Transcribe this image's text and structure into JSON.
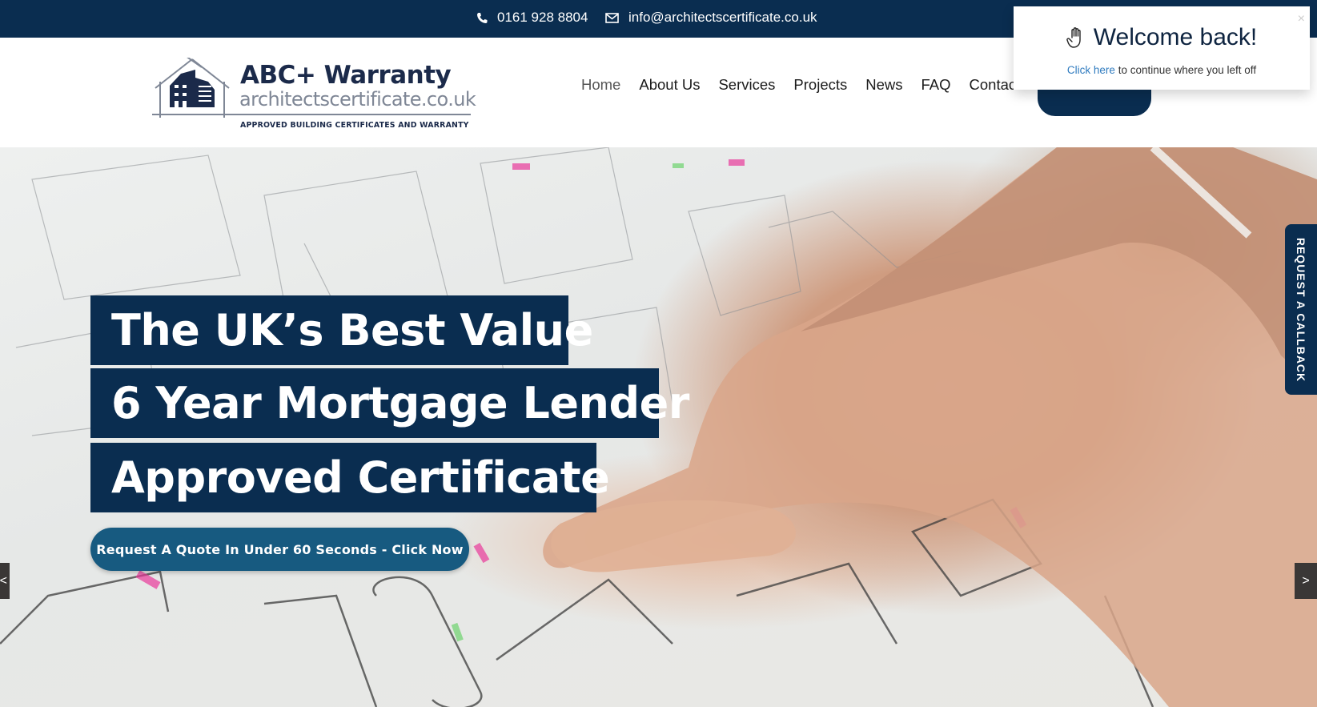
{
  "topbar": {
    "phone": "0161 928 8804",
    "phone_icon": "phone-icon",
    "email": "info@architectscertificate.co.uk",
    "email_icon": "envelope-icon"
  },
  "logo": {
    "brand": "ABC+ Warranty",
    "domain": "architectscertificate.co.uk",
    "tagline": "APPROVED BUILDING CERTIFICATES AND WARRANTY",
    "icon": "house-buildings-icon"
  },
  "nav": {
    "items": [
      {
        "label": "Home",
        "active": true
      },
      {
        "label": "About Us"
      },
      {
        "label": "Services"
      },
      {
        "label": "Projects"
      },
      {
        "label": "News"
      },
      {
        "label": "FAQ"
      },
      {
        "label": "Contact"
      }
    ]
  },
  "hero": {
    "lines": [
      "The UK’s Best Value",
      "6 Year Mortgage Lender",
      "Approved Certificate"
    ],
    "cta": "Request A Quote In Under 60 Seconds - Click Now",
    "prev_arrow": "<",
    "next_arrow": ">"
  },
  "callback_tab": "REQUEST A CALLBACK",
  "popup": {
    "icon": "raised-hand-icon",
    "title": "Welcome back!",
    "link": "Click here",
    "text": " to continue where you left off",
    "close": "×"
  },
  "colors": {
    "navy": "#0a2d50",
    "cta_blue": "#175a80",
    "link_blue": "#2f7bbf",
    "logo_gray": "#7f8796"
  }
}
